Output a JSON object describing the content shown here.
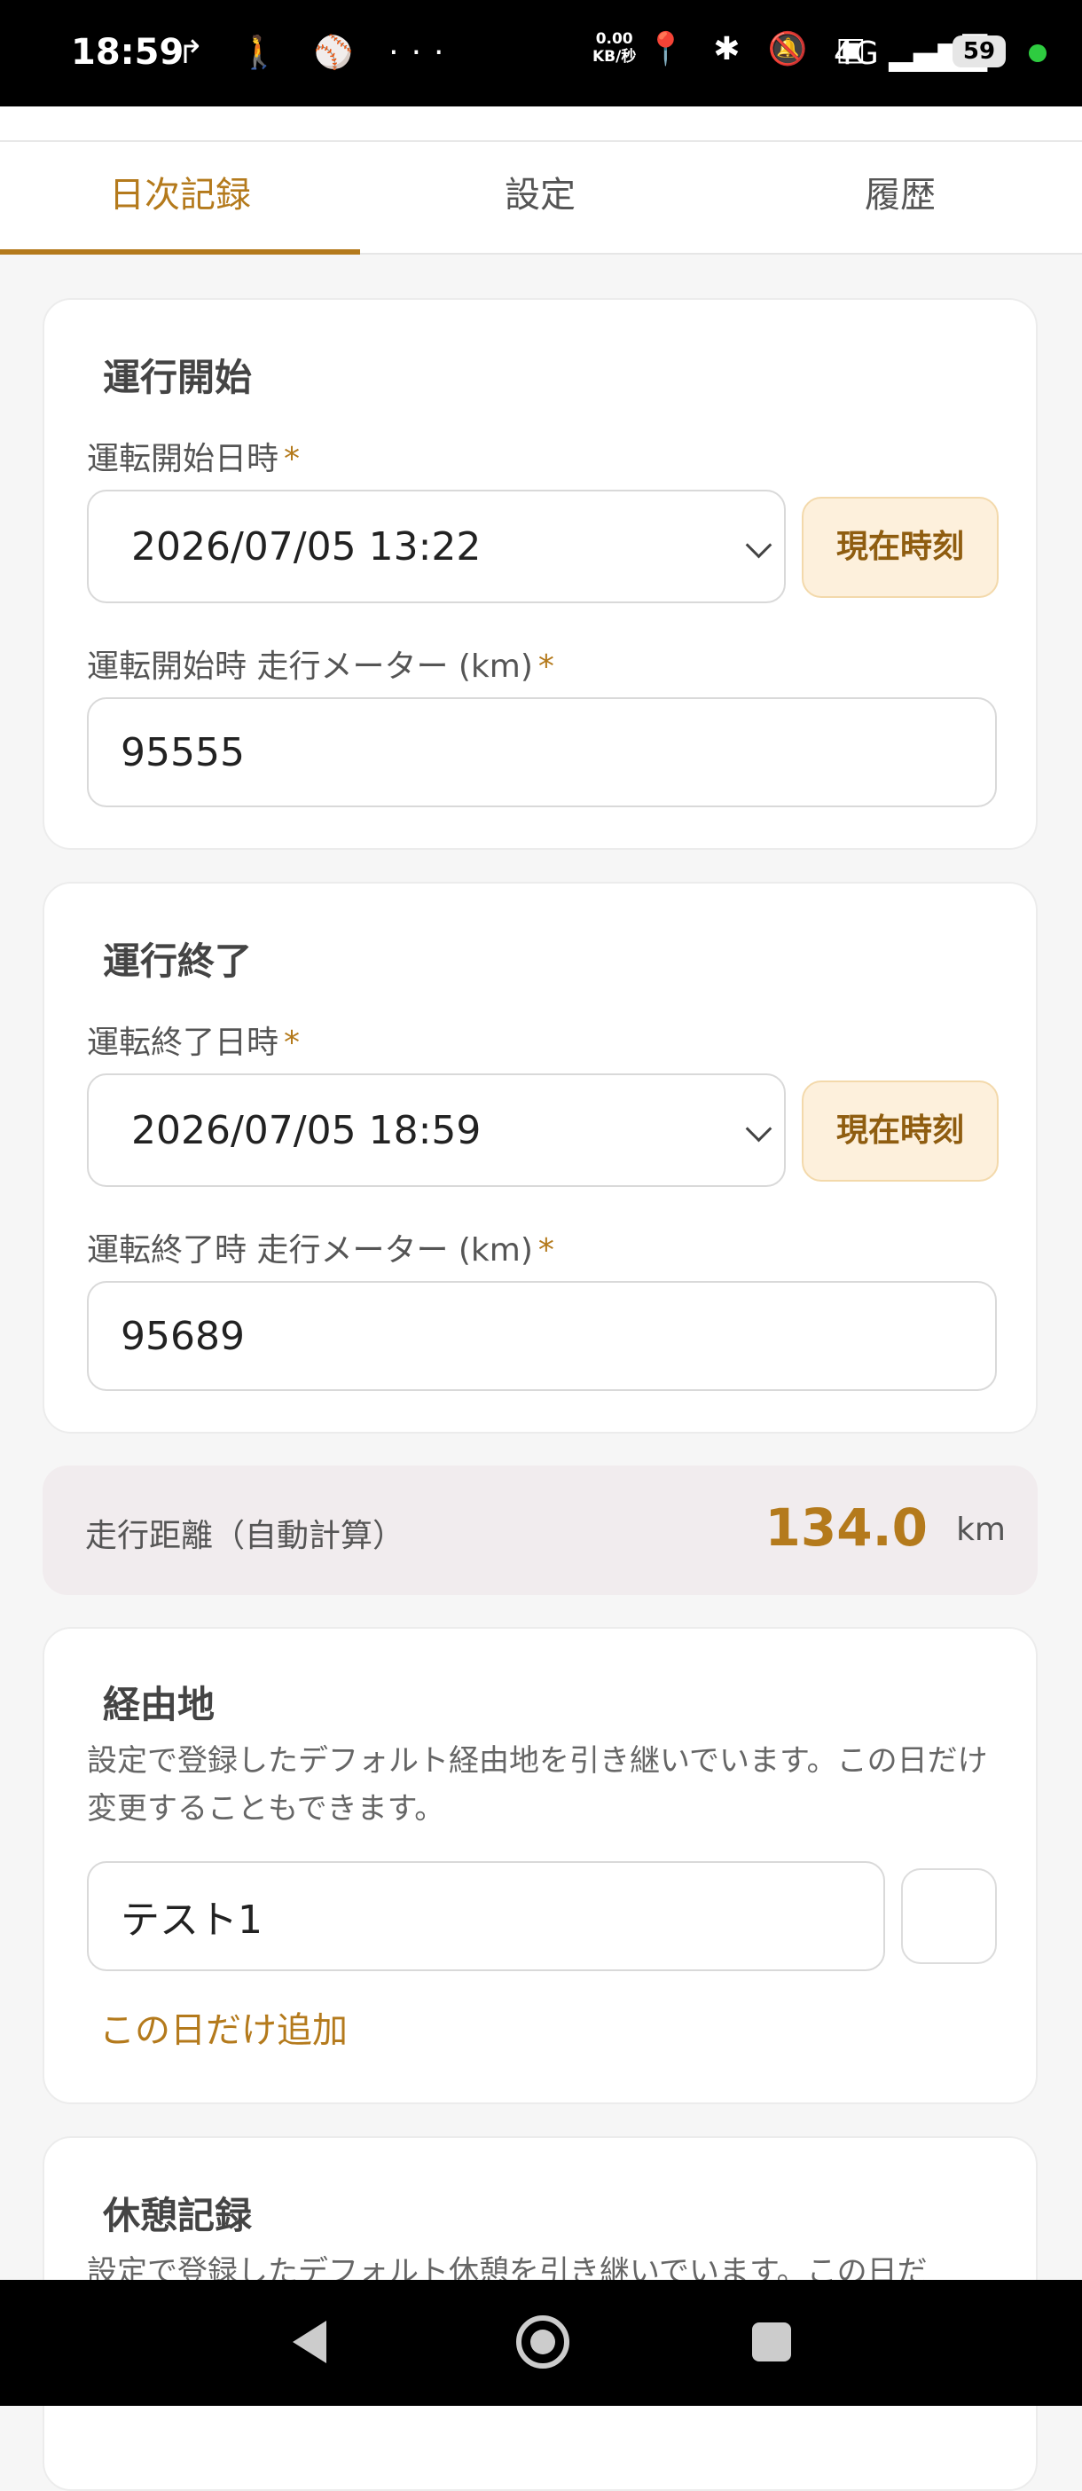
{
  "status": {
    "time": "18:59",
    "left_icons": "↱ 🚶 ⚾ ···",
    "net_speed_top": "0.00",
    "net_speed_bottom": "KB/秒",
    "right_icons": "📍 ✱ 🔕 ▣",
    "network": "4G",
    "battery": "59"
  },
  "tabs": [
    {
      "label": "日次記録"
    },
    {
      "label": "設定"
    },
    {
      "label": "履歴"
    }
  ],
  "start": {
    "title": "運行開始",
    "datetime_label": "運転開始日時",
    "datetime_value": "2026/07/05 13:22",
    "now_button": "現在時刻",
    "meter_label": "運転開始時 走行メーター (km)",
    "meter_value": "95555"
  },
  "end": {
    "title": "運行終了",
    "datetime_label": "運転終了日時",
    "datetime_value": "2026/07/05 18:59",
    "now_button": "現在時刻",
    "meter_label": "運転終了時 走行メーター (km)",
    "meter_value": "95689"
  },
  "required_mark": "*",
  "distance": {
    "label": "走行距離（自動計算）",
    "value": "134.0",
    "unit": "km"
  },
  "via": {
    "title": "経由地",
    "description": "設定で登録したデフォルト経由地を引き継いでいます。この日だけ変更することもできます。",
    "item_value": "テスト1",
    "add_link": "この日だけ追加"
  },
  "rest": {
    "title": "休憩記録",
    "description": "設定で登録したデフォルト休憩を引き継いでいます。この日だ"
  }
}
